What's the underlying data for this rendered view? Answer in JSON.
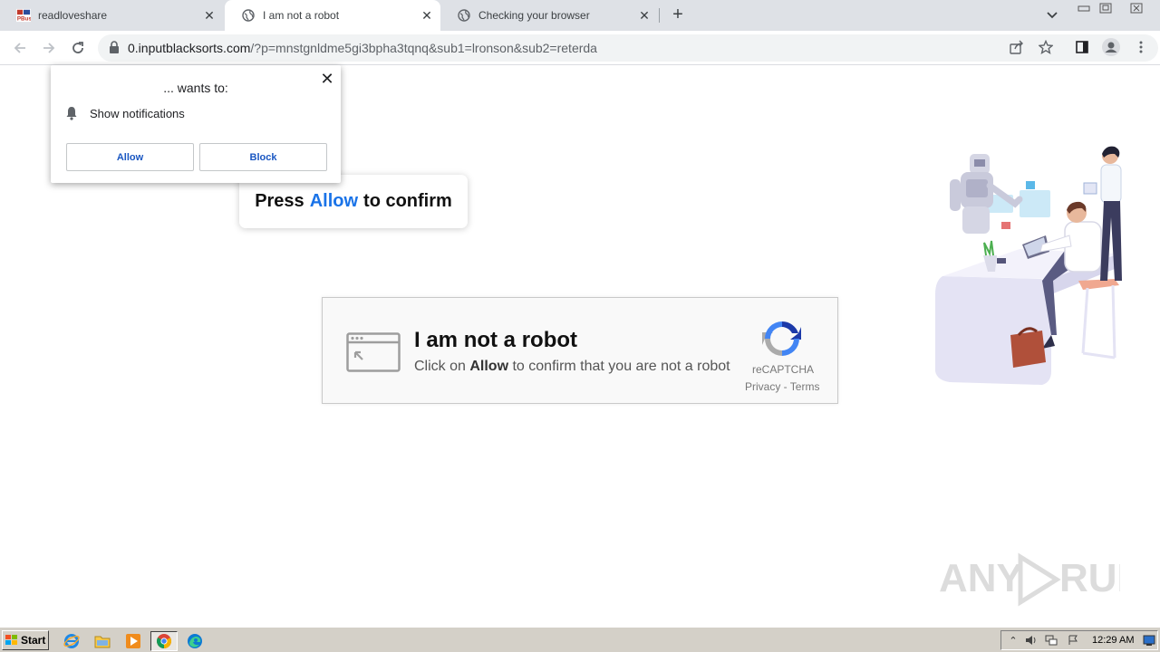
{
  "browser": {
    "tabs": [
      {
        "title": "readloveshare",
        "favicon": "pbus-logo-icon",
        "active": false
      },
      {
        "title": "I am not a robot",
        "favicon": "globe-icon",
        "active": true
      },
      {
        "title": "Checking your browser",
        "favicon": "globe-icon",
        "active": false
      }
    ],
    "url_host": "0.inputblacksorts.com",
    "url_path": "/?p=mnstgnldme5gi3bpha3tqnq&sub1=lronson&sub2=reterda"
  },
  "permission_prompt": {
    "wants": "... wants to:",
    "permission": "Show notifications",
    "allow_label": "Allow",
    "block_label": "Block"
  },
  "press_banner": {
    "before": "Press",
    "highlight": "Allow",
    "after": "to confirm",
    "highlight_color": "#1a73e8"
  },
  "captcha": {
    "heading": "I am not a robot",
    "sub_before": "Click on",
    "sub_bold": "Allow",
    "sub_after": "to confirm that you are not a robot",
    "brand": "reCAPTCHA",
    "links": "Privacy - Terms"
  },
  "watermark": "ANY RUN",
  "taskbar": {
    "start_label": "Start",
    "clock": "12:29 AM",
    "apps": [
      "ie-icon",
      "folder-icon",
      "media-player-icon",
      "chrome-icon",
      "edge-icon"
    ]
  }
}
